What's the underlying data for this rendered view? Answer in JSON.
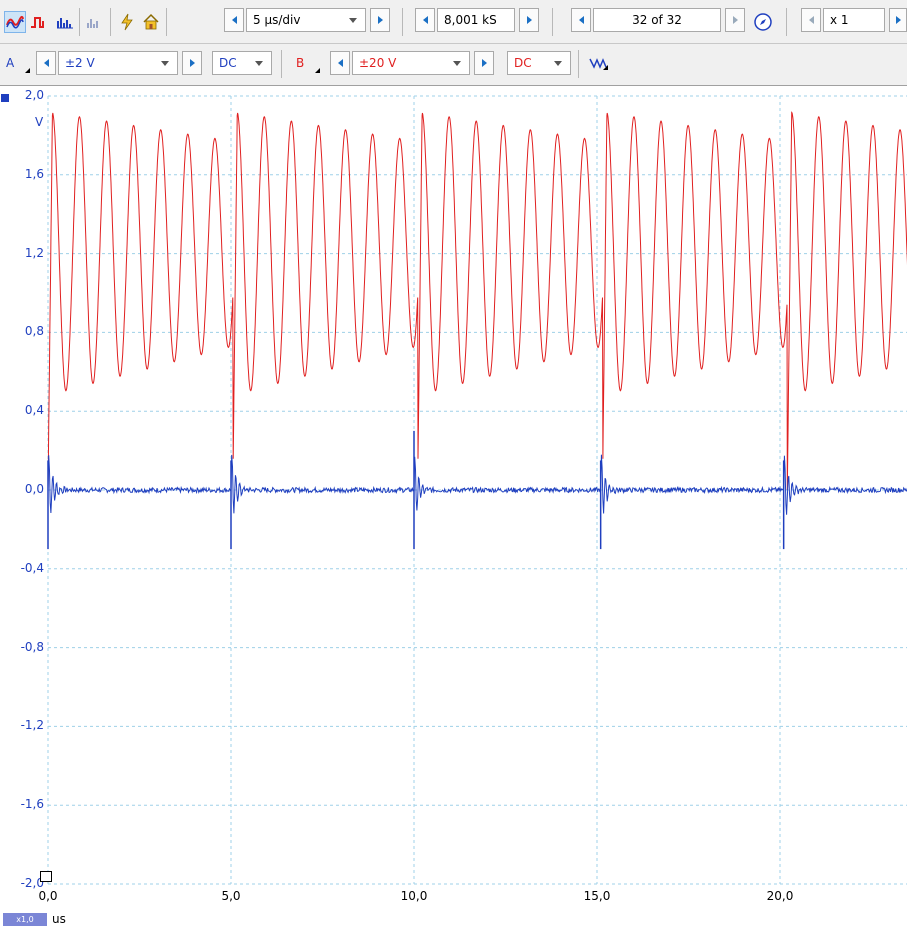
{
  "toolbar_top": {
    "timebase": "5 µs/div",
    "samples": "8,001 kS",
    "capture": "32 of 32",
    "zoom": "x 1"
  },
  "channels": {
    "a": {
      "label": "A",
      "range": "±2 V",
      "coupling": "DC",
      "color": "#1f3fbf"
    },
    "b": {
      "label": "B",
      "range": "±20 V",
      "coupling": "DC",
      "color": "#e02020"
    }
  },
  "plot": {
    "y_unit": "V",
    "x_unit": "us",
    "x_scale_badge": "x1,0",
    "y_ticks": [
      "2,0",
      "1,6",
      "1,2",
      "0,8",
      "0,4",
      "0,0",
      "-0,4",
      "-0,8",
      "-1,2",
      "-1,6",
      "-2,0"
    ],
    "x_ticks": [
      "0,0",
      "5,0",
      "10,0",
      "15,0",
      "20,0"
    ]
  },
  "chart_data": {
    "type": "line",
    "xlabel": "us",
    "ylabel": "V",
    "xlim": [
      0,
      23.5
    ],
    "ylim": [
      -2.0,
      2.0
    ],
    "grid": true,
    "series": [
      {
        "color": "#e02020",
        "description": "damped ringing burst repeating every ~5.05 us, peaks ~1.9 V decaying to ~1.7 V, troughs ~0.45 V rising to ~0.8 V",
        "period_us": 5.05,
        "ring_period_us": 0.74,
        "values_first_burst": {
          "x": [
            0.0,
            0.15,
            0.52,
            0.9,
            1.27,
            1.64,
            2.01,
            2.38,
            2.75,
            3.12,
            3.49,
            3.86,
            4.23,
            4.6,
            4.97
          ],
          "y": [
            0.0,
            1.93,
            0.47,
            1.88,
            0.55,
            1.81,
            0.61,
            1.77,
            0.66,
            1.74,
            0.7,
            1.71,
            0.74,
            1.69,
            0.78
          ]
        }
      },
      {
        "color": "#1f3fbf",
        "description": "near-zero trace with spikes at each edge (~+0.15 V / -0.3 V)",
        "spikes_at_us": [
          0.0,
          5.0,
          10.0,
          15.1,
          20.1
        ],
        "baseline": 0.0
      }
    ]
  }
}
